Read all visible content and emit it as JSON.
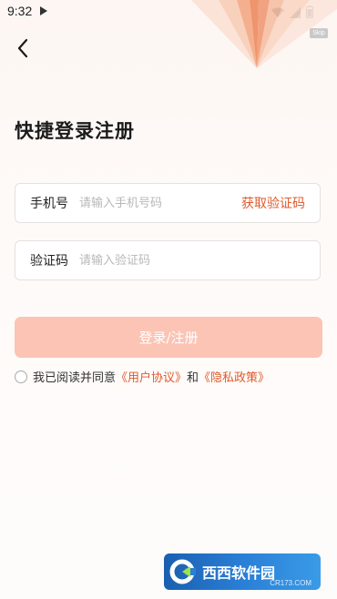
{
  "status_bar": {
    "time": "9:32",
    "icons": [
      "play-icon",
      "wifi-icon",
      "signal-icon",
      "battery-icon"
    ]
  },
  "decoration": {
    "corner_label": "Skip"
  },
  "header": {
    "back_icon": "chevron-left-icon",
    "title": "快捷登录注册"
  },
  "form": {
    "phone": {
      "label": "手机号",
      "placeholder": "请输入手机号码",
      "value": "",
      "action_label": "获取验证码"
    },
    "code": {
      "label": "验证码",
      "placeholder": "请输入验证码",
      "value": ""
    },
    "submit_label": "登录/注册"
  },
  "agreement": {
    "checked": false,
    "prefix": "我已阅读并同意",
    "user_agreement": "《用户协议》",
    "conjunction": "和",
    "privacy_policy": "《隐私政策》"
  },
  "watermark": {
    "name": "西西软件园",
    "sub": "CR173.COM"
  },
  "colors": {
    "accent": "#e05a2c",
    "button_disabled": "#fbc4b4",
    "background": "#fdf6f2"
  }
}
